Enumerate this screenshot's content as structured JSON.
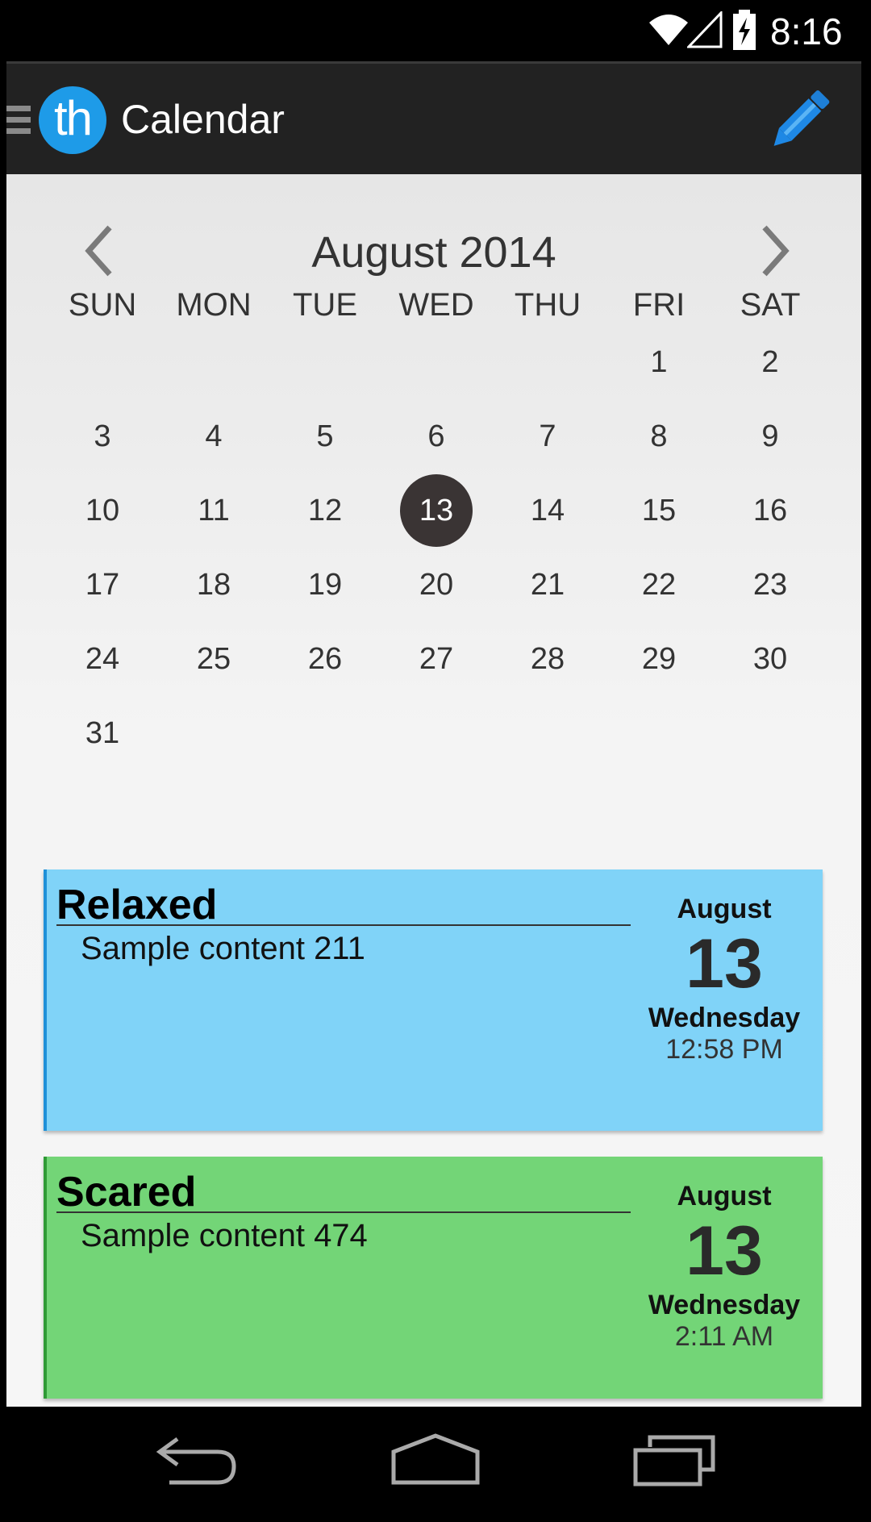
{
  "status_bar": {
    "time": "8:16"
  },
  "action_bar": {
    "logo_text": "th",
    "title": "Calendar"
  },
  "calendar": {
    "month_label": "August 2014",
    "weekdays": [
      "SUN",
      "MON",
      "TUE",
      "WED",
      "THU",
      "FRI",
      "SAT"
    ],
    "weeks": [
      [
        "",
        "",
        "",
        "",
        "",
        "1",
        "2"
      ],
      [
        "3",
        "4",
        "5",
        "6",
        "7",
        "8",
        "9"
      ],
      [
        "10",
        "11",
        "12",
        "13",
        "14",
        "15",
        "16"
      ],
      [
        "17",
        "18",
        "19",
        "20",
        "21",
        "22",
        "23"
      ],
      [
        "24",
        "25",
        "26",
        "27",
        "28",
        "29",
        "30"
      ],
      [
        "31",
        "",
        "",
        "",
        "",
        "",
        ""
      ]
    ],
    "selected_day": "13"
  },
  "entries": [
    {
      "mood": "Relaxed",
      "content": "Sample content 211",
      "month": "August",
      "day": "13",
      "weekday": "Wednesday",
      "time": "12:58 PM",
      "color": "#80d3f8"
    },
    {
      "mood": "Scared",
      "content": "Sample content 474",
      "month": "August",
      "day": "13",
      "weekday": "Wednesday",
      "time": "2:11 AM",
      "color": "#73d577"
    }
  ],
  "colors": {
    "action_bar": "#222222",
    "accent": "#1e9be8",
    "selected_day": "#3a3434"
  },
  "icons": {
    "status": [
      "wifi-icon",
      "signal-icon",
      "battery-charging-icon"
    ],
    "action_bar": [
      "menu-icon",
      "app-logo",
      "edit-pencil-icon"
    ],
    "calendar": [
      "chevron-left-icon",
      "chevron-right-icon"
    ],
    "nav_bar": [
      "back-icon",
      "home-icon",
      "recents-icon"
    ]
  }
}
